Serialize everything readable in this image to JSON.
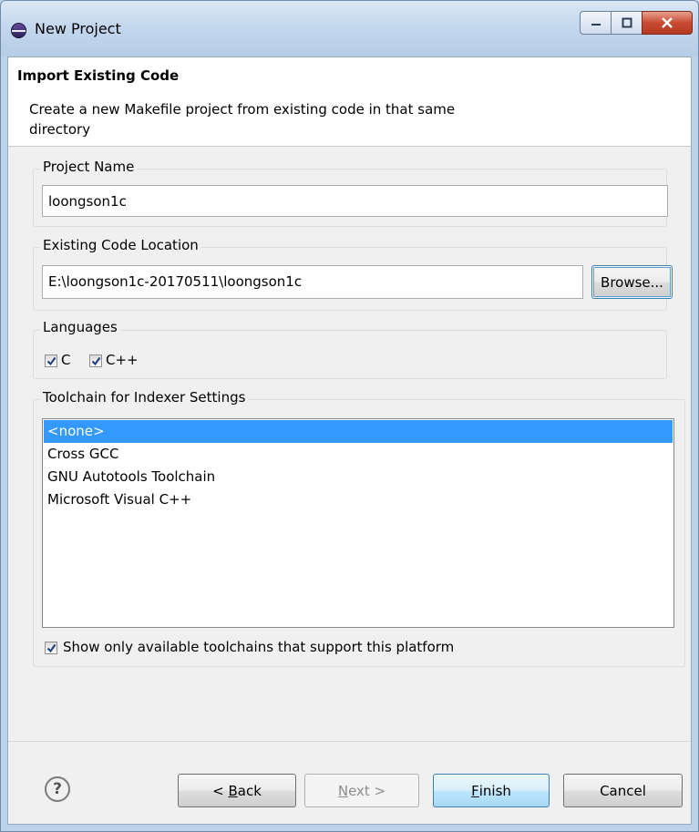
{
  "window": {
    "title": "New Project",
    "icon": "eclipse-icon"
  },
  "header": {
    "title": "Import Existing Code",
    "description": "Create a new Makefile project from existing code in that same directory"
  },
  "project_name": {
    "label": "Project Name",
    "value": "loongson1c"
  },
  "code_location": {
    "label": "Existing Code Location",
    "value": "E:\\loongson1c-20170511\\loongson1c",
    "browse_label": "Browse..."
  },
  "languages": {
    "label": "Languages",
    "items": [
      {
        "label": "C",
        "checked": true
      },
      {
        "label": "C++",
        "checked": true
      }
    ]
  },
  "toolchain": {
    "label": "Toolchain for Indexer Settings",
    "items": [
      {
        "label": "<none>",
        "selected": true
      },
      {
        "label": "Cross GCC",
        "selected": false
      },
      {
        "label": "GNU Autotools Toolchain",
        "selected": false
      },
      {
        "label": "Microsoft Visual C++",
        "selected": false
      }
    ],
    "show_only_label": "Show only available toolchains that support this platform",
    "show_only_checked": true
  },
  "footer": {
    "help_icon": "help-icon",
    "back_prefix": "< ",
    "back_mnemonic": "B",
    "back_rest": "ack",
    "next_mnemonic": "N",
    "next_rest": "ext >",
    "finish_mnemonic": "F",
    "finish_rest": "inish",
    "cancel_label": "Cancel"
  },
  "colors": {
    "selection": "#3399ff",
    "dialog_bg": "#f0f0f0",
    "title_bar": "#c4d8ee",
    "close_button": "#c94a32"
  }
}
